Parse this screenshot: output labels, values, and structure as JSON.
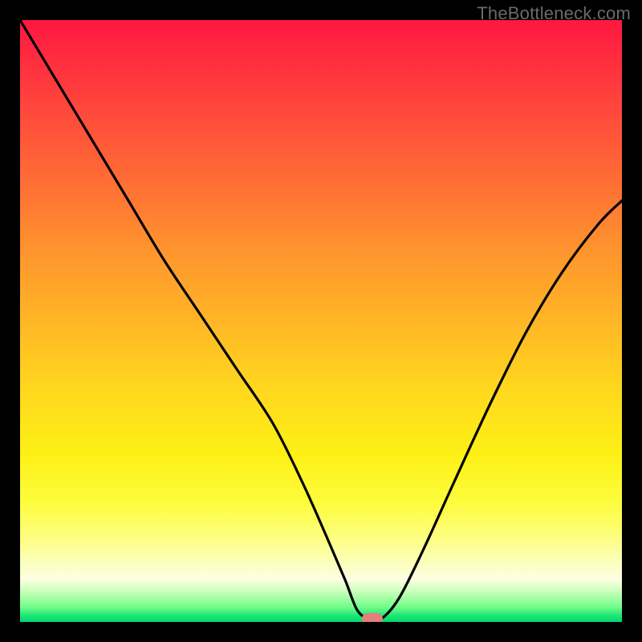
{
  "watermark": "TheBottleneck.com",
  "chart_data": {
    "type": "line",
    "title": "",
    "xlabel": "",
    "ylabel": "",
    "xlim": [
      0,
      100
    ],
    "ylim": [
      0,
      100
    ],
    "grid": false,
    "legend": false,
    "series": [
      {
        "name": "bottleneck-curve",
        "x": [
          0,
          6,
          12,
          18,
          24,
          30,
          36,
          42,
          47,
          51,
          54,
          56,
          58,
          60,
          63,
          67,
          72,
          78,
          84,
          90,
          96,
          100
        ],
        "y": [
          100,
          90,
          80,
          70,
          60,
          51,
          42,
          33,
          23,
          14,
          7,
          2,
          0.5,
          0.5,
          4,
          12,
          23,
          36,
          48,
          58,
          66,
          70
        ]
      }
    ],
    "marker": {
      "x": 58.5,
      "y": 0.5
    },
    "background_gradient": {
      "top": "#ff1741",
      "bottom": "#00d774",
      "stops": [
        "#ff1741",
        "#ff4b3b",
        "#ff932e",
        "#ffd91d",
        "#fdfc3b",
        "#fcffe2",
        "#1be574",
        "#00d774"
      ]
    }
  }
}
